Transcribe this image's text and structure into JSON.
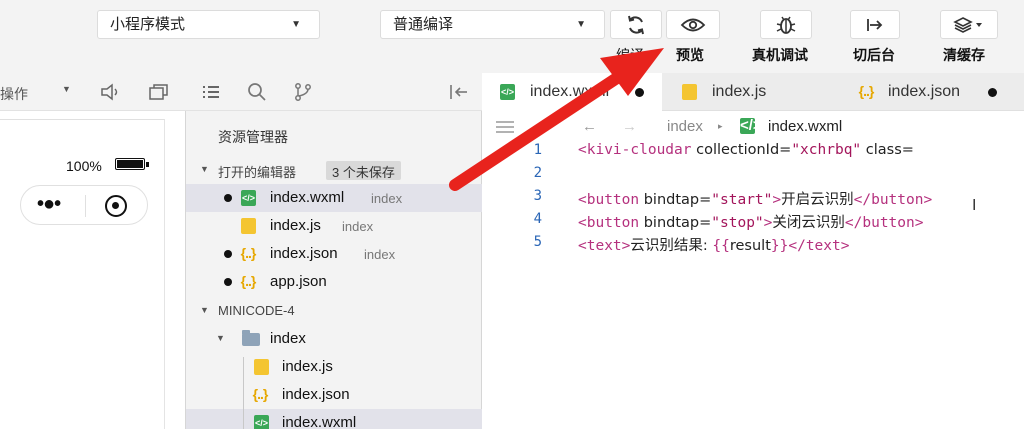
{
  "toolbar": {
    "mode_select": "小程序模式",
    "compile_select": "普通编译",
    "buttons": {
      "compile": "编译",
      "preview": "预览",
      "remote_debug": "真机调试",
      "background": "切后台",
      "clear_cache": "清缓存"
    }
  },
  "simulator": {
    "operation_label": "操作",
    "battery_percent": "100%"
  },
  "explorer": {
    "title": "资源管理器",
    "open_editors": {
      "label": "打开的编辑器",
      "badge": "3 个未保存",
      "files": [
        {
          "name": "index.wxml",
          "dir": "index",
          "type": "wxml",
          "unsaved": true,
          "selected": true
        },
        {
          "name": "index.js",
          "dir": "index",
          "type": "js",
          "unsaved": false,
          "selected": false
        },
        {
          "name": "index.json",
          "dir": "index",
          "type": "json",
          "unsaved": true,
          "selected": false
        },
        {
          "name": "app.json",
          "dir": "",
          "type": "json",
          "unsaved": true,
          "selected": false
        }
      ]
    },
    "project": {
      "label": "MINICODE-4",
      "folder": "index",
      "files": [
        {
          "name": "index.js",
          "type": "js"
        },
        {
          "name": "index.json",
          "type": "json"
        },
        {
          "name": "index.wxml",
          "type": "wxml"
        }
      ]
    }
  },
  "editor": {
    "tabs": [
      {
        "name": "index.wxml",
        "type": "wxml",
        "unsaved": true,
        "active": true
      },
      {
        "name": "index.js",
        "type": "js",
        "unsaved": false,
        "active": false
      },
      {
        "name": "index.json",
        "type": "json",
        "unsaved": true,
        "active": false
      }
    ],
    "breadcrumb": {
      "folder": "index",
      "file": "index.wxml"
    },
    "lines": [
      {
        "num": "1",
        "text": "<kivi-cloudar collectionId=\"xchrbq\" class="
      },
      {
        "num": "2",
        "text": ""
      },
      {
        "num": "3",
        "text": "<button bindtap=\"start\">开启云识别</button>"
      },
      {
        "num": "4",
        "text": "<button bindtap=\"stop\">关闭云识别</button>"
      },
      {
        "num": "5",
        "text": "<text>云识别结果: {{result}}</text>"
      }
    ]
  },
  "colors": {
    "annotation_arrow": "#e8231d",
    "tag": "#b5317e",
    "line_number": "#2b66b6",
    "wxml_icon": "#3aa757",
    "js_icon": "#f4c531",
    "json_icon": "#e6a700"
  },
  "icons": [
    "chevron-down-icon",
    "refresh-icon",
    "eye-icon",
    "bug-icon",
    "switch-background-icon",
    "layers-icon",
    "speaker-icon",
    "window-icon",
    "list-icon",
    "search-icon",
    "branch-icon",
    "collapse-panel-icon",
    "back-arrow-icon",
    "forward-arrow-icon",
    "folder-icon",
    "file-wxml-icon",
    "file-js-icon",
    "file-json-icon"
  ]
}
